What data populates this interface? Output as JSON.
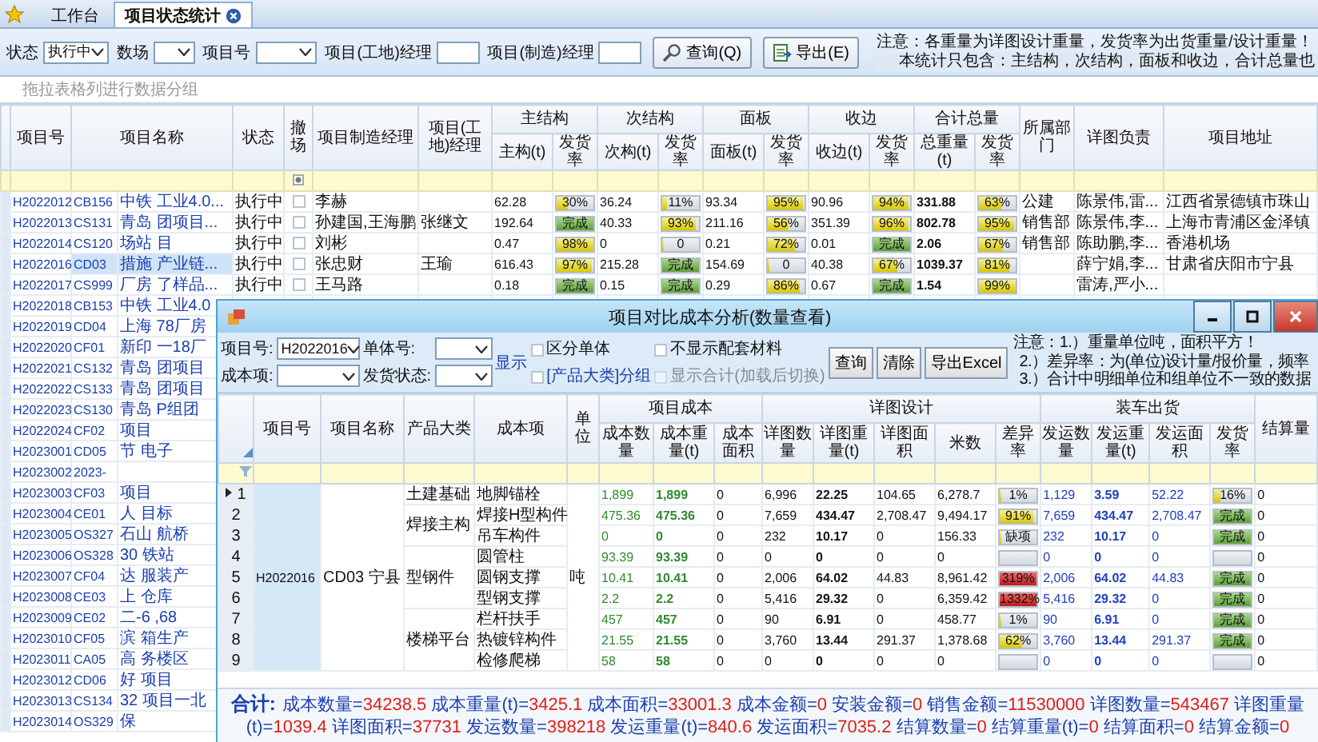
{
  "tabs": [
    {
      "label": "工作台",
      "selected": false,
      "closable": false
    },
    {
      "label": "项目状态统计",
      "selected": true,
      "closable": true
    }
  ],
  "filters": [
    {
      "label": "状态",
      "kind": "select",
      "value": "执行中"
    },
    {
      "label": "数场",
      "kind": "select"
    },
    {
      "label": "项目号",
      "kind": "select"
    },
    {
      "label": "项目(工地)经理",
      "kind": "input"
    },
    {
      "label": "项目(制造)经理",
      "kind": "input"
    }
  ],
  "buttons": [
    {
      "label": "查询(Q)"
    },
    {
      "label": "导出(E)"
    }
  ],
  "notes": [
    "注意：各重量为详图设计重量，发货率为出货重量/设计重量！",
    "本统计只包含：主结构，次结构，面板和收边，合计总量也"
  ],
  "group_hint": "拖拉表格列进行数据分组",
  "table": {
    "left_columns": [
      "项目号",
      "项目名称",
      "状态",
      "撤场",
      "项目制造经理",
      "项目(工地)经理"
    ],
    "groups": [
      {
        "label": "主结构",
        "sub": [
          "主构(t)",
          "发货率"
        ]
      },
      {
        "label": "次结构",
        "sub": [
          "次构(t)",
          "发货率"
        ]
      },
      {
        "label": "面板",
        "sub": [
          "面板(t)",
          "发货率"
        ]
      },
      {
        "label": "收边",
        "sub": [
          "收边(t)",
          "发货率"
        ]
      },
      {
        "label": "合计总量",
        "sub": [
          "总重量(t)",
          "发货率"
        ]
      }
    ],
    "right_columns": [
      "所属部门",
      "详图负责",
      "项目地址"
    ],
    "withdrawn_filter": {
      "indeterminate": true
    },
    "rows": [
      {
        "id": "H2022012",
        "code": "CB156",
        "name": "中铁 工业4.0...",
        "selected": false,
        "status": "执行中",
        "withdrawn": false,
        "mfg_manager": "李赫",
        "weights": [
          "62.28",
          "36.24",
          "93.34",
          "90.96",
          "331.88"
        ],
        "rates": [
          {
            "text": "30%",
            "level": 0.3
          },
          {
            "text": "11%",
            "level": 0.11
          },
          {
            "text": "95%",
            "level": 0.95
          },
          {
            "text": "94%",
            "level": 0.94
          },
          {
            "text": "63%",
            "level": 0.63
          }
        ],
        "dept": "公建",
        "detail_owner": "陈景伟,雷...",
        "address": "江西省景德镇市珠山"
      },
      {
        "id": "H2022013",
        "code": "CS131",
        "name": "青岛 团项目...",
        "selected": false,
        "status": "执行中",
        "withdrawn": false,
        "mfg_manager": "孙建国,王海鹏",
        "site_manager": "张继文",
        "weights": [
          "192.64",
          "40.33",
          "211.16",
          "351.39",
          "802.78"
        ],
        "rates": [
          {
            "text": "完成",
            "level": 1
          },
          {
            "text": "93%",
            "level": 0.93
          },
          {
            "text": "56%",
            "level": 0.56
          },
          {
            "text": "96%",
            "level": 0.96
          },
          {
            "text": "95%",
            "level": 0.95
          }
        ],
        "dept": "销售部",
        "detail_owner": "陈景伟,李...",
        "address": "上海市青浦区金泽镇"
      },
      {
        "id": "H2022014",
        "code": "CS120",
        "name": "场站 目",
        "selected": false,
        "status": "执行中",
        "withdrawn": false,
        "mfg_manager": "刘彬",
        "weights": [
          "0.47",
          "0",
          "0.21",
          "0.01",
          "2.06"
        ],
        "rates": [
          {
            "text": "98%",
            "level": 0.98
          },
          {
            "text": "0",
            "level": 0
          },
          {
            "text": "72%",
            "level": 0.72
          },
          {
            "text": "完成",
            "level": 1
          },
          {
            "text": "67%",
            "level": 0.67
          }
        ],
        "dept": "销售部",
        "detail_owner": "陈助鹏,李...",
        "address": "香港机场"
      },
      {
        "id": "H2022016",
        "code": "CD03",
        "name": "措施 产业链...",
        "selected": true,
        "status": "执行中",
        "withdrawn": false,
        "mfg_manager": "张忠财",
        "site_manager": "王瑜",
        "weights": [
          "616.43",
          "215.28",
          "154.69",
          "40.38",
          "1039.37"
        ],
        "rates": [
          {
            "text": "97%",
            "level": 0.97
          },
          {
            "text": "完成",
            "level": 1
          },
          {
            "text": "0",
            "level": 0
          },
          {
            "text": "67%",
            "level": 0.67
          },
          {
            "text": "81%",
            "level": 0.81
          }
        ],
        "detail_owner": "薛宁娟,李...",
        "address": "甘肃省庆阳市宁县"
      },
      {
        "id": "H2022017",
        "code": "CS999",
        "name": "厂房 了样品...",
        "selected": false,
        "status": "执行中",
        "withdrawn": false,
        "mfg_manager": "王马路",
        "weights": [
          "0.18",
          "0.15",
          "0.29",
          "0.67",
          "1.54"
        ],
        "rates": [
          {
            "text": "完成",
            "level": 1
          },
          {
            "text": "完成",
            "level": 1
          },
          {
            "text": "86%",
            "level": 0.86
          },
          {
            "text": "完成",
            "level": 1
          },
          {
            "text": "99%",
            "level": 0.99
          }
        ],
        "detail_owner": "雷涛,严小..."
      },
      {
        "id": "H2022018",
        "code": "CB153",
        "name": "中铁 工业4.0",
        "selected": false
      },
      {
        "id": "H2022019",
        "code": "CD04",
        "name": "上海 78厂房",
        "selected": false
      },
      {
        "id": "H2022020",
        "code": "CF01",
        "name": "新印 一18厂",
        "selected": false
      },
      {
        "id": "H2022021",
        "code": "CS132",
        "name": "青岛 团项目",
        "selected": false
      },
      {
        "id": "H2022022",
        "code": "CS133",
        "name": "青岛 团项目",
        "selected": false
      },
      {
        "id": "H2022023",
        "code": "CS130",
        "name": "青岛 P组团",
        "selected": false
      },
      {
        "id": "H2022024",
        "code": "CF02",
        "name": "项目",
        "selected": false
      },
      {
        "id": "H2023001",
        "code": "CD05",
        "name": "节 电子",
        "selected": false
      },
      {
        "id": "H2023002",
        "code": "2023-",
        "selected": false
      },
      {
        "id": "H2023003",
        "code": "CF03",
        "name": "项目",
        "selected": false
      },
      {
        "id": "H2023004",
        "code": "CE01",
        "name": "人 目标",
        "selected": false
      },
      {
        "id": "H2023005",
        "code": "OS327",
        "name": "石山 航桥",
        "selected": false
      },
      {
        "id": "H2023006",
        "code": "OS328",
        "name": "30 铁站",
        "selected": false
      },
      {
        "id": "H2023007",
        "code": "CF04",
        "name": "达 服装产",
        "selected": false
      },
      {
        "id": "H2023008",
        "code": "CE03",
        "name": "上 仓库",
        "selected": false
      },
      {
        "id": "H2023009",
        "code": "CE02",
        "name": "二-6 ,68",
        "selected": false
      },
      {
        "id": "H2023010",
        "code": "CF05",
        "name": "滨 箱生产",
        "selected": false
      },
      {
        "id": "H2023011",
        "code": "CA05",
        "name": "高 务楼区",
        "selected": false
      },
      {
        "id": "H2023012",
        "code": "CD06",
        "name": "好 项目",
        "selected": false
      },
      {
        "id": "H2023013",
        "code": "CS134",
        "name": "32 项目一北",
        "selected": false
      },
      {
        "id": "H2023014",
        "code": "OS329",
        "name": "保",
        "selected": false
      }
    ]
  },
  "dialog": {
    "title": "项目对比成本分析(数量查看)",
    "fields": [
      {
        "label": "项目号:",
        "value": "H2022016"
      },
      {
        "label": "单体号:"
      },
      {
        "label": "成本项:"
      },
      {
        "label": "发货状态:"
      }
    ],
    "show_link": "显示",
    "options": [
      {
        "label": "区分单体",
        "checked": false,
        "disabled": false,
        "highlight": false
      },
      {
        "label": "不显示配套材料",
        "checked": false,
        "disabled": false,
        "highlight": false
      },
      {
        "label": "[产品大类]分组",
        "checked": false,
        "disabled": false,
        "highlight": true
      },
      {
        "label": "显示合计(加载后切换)",
        "checked": false,
        "disabled": true,
        "highlight": false
      }
    ],
    "buttons": [
      "查询",
      "清除",
      "导出Excel"
    ],
    "notes": [
      "注意：1.）重量单位吨，面积平方！",
      "2.）差异率：为(单位)设计量/报价量，频率",
      "3.）合计中明细单位和组单位不一致的数据"
    ],
    "left_columns": [
      "项目号",
      "项目名称",
      "产品大类",
      "成本项",
      "单位"
    ],
    "groups": [
      {
        "label": "项目成本",
        "sub": [
          "成本数量",
          "成本重量(t)",
          "成本面积"
        ]
      },
      {
        "label": "详图设计",
        "sub": [
          "详图数量",
          "详图重量(t)",
          "详图面积",
          "米数",
          "差异率"
        ]
      },
      {
        "label": "装车出货",
        "sub": [
          "发运数量",
          "发运重量(t)",
          "发运面积",
          "发货率"
        ]
      }
    ],
    "right_columns": [
      "结算量"
    ],
    "project_id": "H2022016",
    "project_name": "CD03 宁县",
    "unit": "吨",
    "categories": [
      {
        "name": "土建基础",
        "rows": [
          {
            "no": "1",
            "current": true,
            "item": "地脚锚栓",
            "cost": [
              "1,899",
              "1,899",
              "0"
            ],
            "detail": [
              "6,996",
              "22.25",
              "104.65",
              "6,278.7"
            ],
            "diff": {
              "text": "1%",
              "level": 0.01,
              "over": false
            },
            "ship": [
              "1,129",
              "3.59",
              "52.22"
            ],
            "ship_rate": {
              "text": "16%",
              "level": 0.16
            },
            "settle": "0"
          }
        ]
      },
      {
        "name": "焊接主构",
        "rows": [
          {
            "no": "2",
            "current": false,
            "item": "焊接H型构件",
            "cost": [
              "475.36",
              "475.36",
              "0"
            ],
            "detail": [
              "7,659",
              "434.47",
              "2,708.47",
              "9,494.17"
            ],
            "diff": {
              "text": "91%",
              "level": 0.91,
              "over": false
            },
            "ship": [
              "7,659",
              "434.47",
              "2,708.47"
            ],
            "ship_rate": {
              "text": "完成",
              "level": 1
            },
            "settle": "0"
          },
          {
            "no": "3",
            "current": false,
            "item": "吊车构件",
            "cost": [
              "0",
              "0",
              "0"
            ],
            "detail": [
              "232",
              "10.17",
              "0",
              "156.33"
            ],
            "diff": {
              "text": "缺项",
              "level": 0,
              "over": false
            },
            "ship": [
              "232",
              "10.17",
              "0"
            ],
            "ship_rate": {
              "text": "完成",
              "level": 1
            },
            "settle": "0"
          }
        ]
      },
      {
        "name": "型钢件",
        "rows": [
          {
            "no": "4",
            "current": false,
            "item": "圆管柱",
            "cost": [
              "93.39",
              "93.39",
              "0"
            ],
            "detail": [
              "0",
              "0",
              "0",
              "0"
            ],
            "ship": [
              "0",
              "0",
              "0"
            ],
            "settle": "0"
          },
          {
            "no": "5",
            "current": false,
            "item": "圆钢支撑",
            "cost": [
              "10.41",
              "10.41",
              "0"
            ],
            "detail": [
              "2,006",
              "64.02",
              "44.83",
              "8,961.42"
            ],
            "diff": {
              "text": "319%",
              "level": 1,
              "over": true
            },
            "ship": [
              "2,006",
              "64.02",
              "44.83"
            ],
            "ship_rate": {
              "text": "完成",
              "level": 1
            },
            "settle": "0"
          },
          {
            "no": "6",
            "current": false,
            "item": "型钢支撑",
            "cost": [
              "2.2",
              "2.2",
              "0"
            ],
            "detail": [
              "5,416",
              "29.32",
              "0",
              "6,359.42"
            ],
            "diff": {
              "text": "1332%",
              "level": 1,
              "over": true
            },
            "ship": [
              "5,416",
              "29.32",
              "0"
            ],
            "ship_rate": {
              "text": "完成",
              "level": 1
            },
            "settle": "0"
          }
        ]
      },
      {
        "name": "楼梯平台",
        "rows": [
          {
            "no": "7",
            "current": false,
            "item": "栏杆扶手",
            "cost": [
              "457",
              "457",
              "0"
            ],
            "detail": [
              "90",
              "6.91",
              "0",
              "458.77"
            ],
            "diff": {
              "text": "1%",
              "level": 0.01,
              "over": false
            },
            "ship": [
              "90",
              "6.91",
              "0"
            ],
            "ship_rate": {
              "text": "完成",
              "level": 1
            },
            "settle": "0"
          },
          {
            "no": "8",
            "current": false,
            "item": "热镀锌构件",
            "cost": [
              "21.55",
              "21.55",
              "0"
            ],
            "detail": [
              "3,760",
              "13.44",
              "291.37",
              "1,378.68"
            ],
            "diff": {
              "text": "62%",
              "level": 0.62,
              "over": false
            },
            "ship": [
              "3,760",
              "13.44",
              "291.37"
            ],
            "ship_rate": {
              "text": "完成",
              "level": 1
            },
            "settle": "0"
          },
          {
            "no": "9",
            "current": false,
            "item": "检修爬梯",
            "cost": [
              "58",
              "58",
              "0"
            ],
            "detail": [
              "0",
              "0",
              "0",
              "0"
            ],
            "ship": [
              "0",
              "0",
              "0"
            ],
            "settle": "0"
          }
        ]
      }
    ],
    "totals_label": "合计:",
    "totals": [
      {
        "label": "成本数量=",
        "value": "34238.5"
      },
      {
        "label": "成本重量(t)=",
        "value": "3425.1"
      },
      {
        "label": "成本面积=",
        "value": "33001.3"
      },
      {
        "label": "成本金额=",
        "value": "0"
      },
      {
        "label": "安装金额=",
        "value": "0"
      },
      {
        "label": "销售金额=",
        "value": "11530000"
      },
      {
        "label": "详图数量=",
        "value": "543467"
      },
      {
        "label": "详图重量(t)=",
        "value": "1039.4"
      },
      {
        "label": "详图面积=",
        "value": "37731"
      },
      {
        "label": "发运数量=",
        "value": "398218"
      },
      {
        "label": "发运重量(t)=",
        "value": "840.6"
      },
      {
        "label": "发运面积=",
        "value": "7035.2"
      },
      {
        "label": "结算数量=",
        "value": "0"
      },
      {
        "label": "结算重量(t)=",
        "value": "0"
      },
      {
        "label": "结算面积=",
        "value": "0"
      },
      {
        "label": "结算金额=",
        "value": "0"
      }
    ]
  }
}
